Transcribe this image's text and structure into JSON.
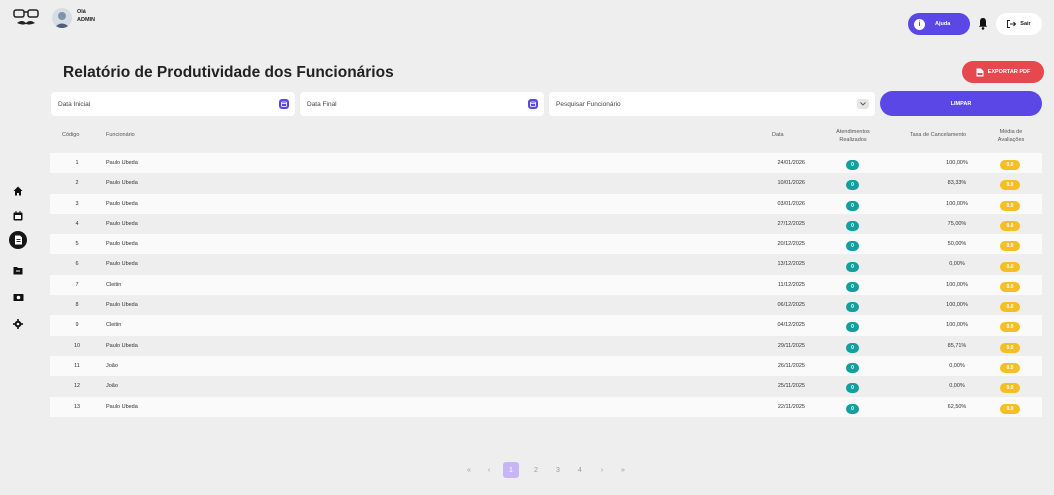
{
  "header": {
    "greeting": "Olá",
    "role": "ADMIN",
    "help_label": "Ajuda",
    "exit_label": "Sair"
  },
  "page": {
    "title": "Relatório de Produtividade dos Funcionários",
    "export_label": "EXPORTAR PDF"
  },
  "filters": {
    "start_date": "Data Inicial",
    "end_date": "Data Final",
    "employee_search": "Pesquisar Funcionário",
    "clear_label": "LIMPAR"
  },
  "table": {
    "headers": {
      "code": "Código",
      "employee": "Funcionário",
      "date": "Data",
      "attendances_1": "Atendimentos",
      "attendances_2": "Realizados",
      "cancel_rate": "Taxa de Cancelamento",
      "rating_1": "Média de",
      "rating_2": "Avaliações"
    },
    "rows": [
      {
        "code": "1",
        "employee": "Paulo Ubeda",
        "date": "24/01/2026",
        "attendances": "0",
        "cancel_rate": "100,00%",
        "rating": "0.0"
      },
      {
        "code": "2",
        "employee": "Paulo Ubeda",
        "date": "10/01/2026",
        "attendances": "0",
        "cancel_rate": "83,33%",
        "rating": "0.0"
      },
      {
        "code": "3",
        "employee": "Paulo Ubeda",
        "date": "03/01/2026",
        "attendances": "0",
        "cancel_rate": "100,00%",
        "rating": "0.0"
      },
      {
        "code": "4",
        "employee": "Paulo Ubeda",
        "date": "27/12/2025",
        "attendances": "0",
        "cancel_rate": "75,00%",
        "rating": "0.0"
      },
      {
        "code": "5",
        "employee": "Paulo Ubeda",
        "date": "20/12/2025",
        "attendances": "0",
        "cancel_rate": "50,00%",
        "rating": "0.0"
      },
      {
        "code": "6",
        "employee": "Paulo Ubeda",
        "date": "13/12/2025",
        "attendances": "0",
        "cancel_rate": "0,00%",
        "rating": "0.0"
      },
      {
        "code": "7",
        "employee": "Cleitin",
        "date": "11/12/2025",
        "attendances": "0",
        "cancel_rate": "100,00%",
        "rating": "0.0"
      },
      {
        "code": "8",
        "employee": "Paulo Ubeda",
        "date": "06/12/2025",
        "attendances": "0",
        "cancel_rate": "100,00%",
        "rating": "0.0"
      },
      {
        "code": "9",
        "employee": "Cleitin",
        "date": "04/12/2025",
        "attendances": "0",
        "cancel_rate": "100,00%",
        "rating": "0.0"
      },
      {
        "code": "10",
        "employee": "Paulo Ubeda",
        "date": "29/11/2025",
        "attendances": "0",
        "cancel_rate": "85,71%",
        "rating": "0.0"
      },
      {
        "code": "11",
        "employee": "João",
        "date": "26/11/2025",
        "attendances": "0",
        "cancel_rate": "0,00%",
        "rating": "0.0"
      },
      {
        "code": "12",
        "employee": "João",
        "date": "25/11/2025",
        "attendances": "0",
        "cancel_rate": "0,00%",
        "rating": "0.0"
      },
      {
        "code": "13",
        "employee": "Paulo Ubeda",
        "date": "22/11/2025",
        "attendances": "0",
        "cancel_rate": "62,50%",
        "rating": "0.0"
      }
    ]
  },
  "pagination": {
    "first": "«",
    "prev": "‹",
    "pages": [
      "1",
      "2",
      "3",
      "4"
    ],
    "next": "›",
    "last": "»",
    "current": "1"
  },
  "colors": {
    "accent": "#5b47e6",
    "danger": "#e5484d",
    "teal": "#149e9e",
    "yellow": "#f4bf26",
    "active_page": "#c8b6f4"
  },
  "icons": {
    "logo": "glasses-mustache-logo-icon",
    "sidebar": [
      "home-icon",
      "calendar-icon",
      "report-icon",
      "folder-icon",
      "money-icon",
      "gear-icon"
    ]
  }
}
